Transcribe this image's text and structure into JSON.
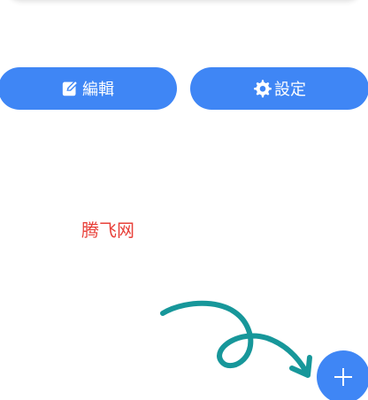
{
  "colors": {
    "accent": "#3f86f5",
    "watermark": "#e8413a",
    "arrow": "#17979a"
  },
  "actions": {
    "edit_label": "編輯",
    "edit_icon": "edit-icon",
    "settings_label": "設定",
    "settings_icon": "gear-icon"
  },
  "watermark": {
    "text": "腾飞网"
  },
  "fab": {
    "icon": "plus-icon"
  }
}
